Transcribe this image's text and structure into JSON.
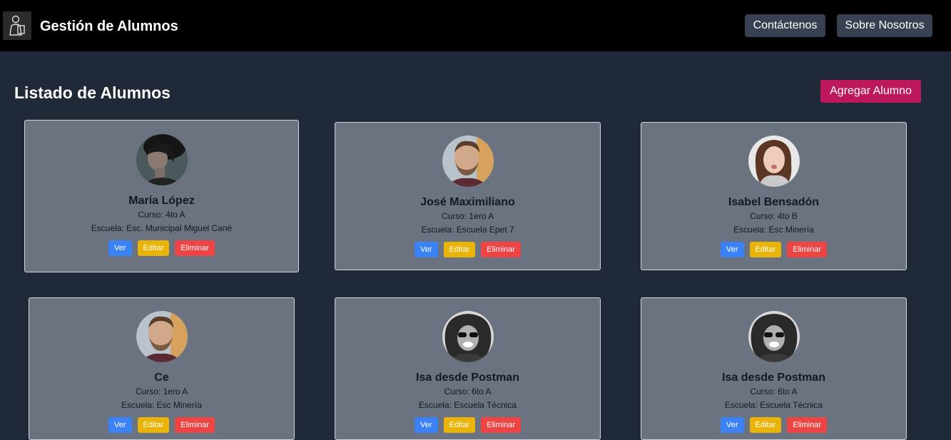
{
  "header": {
    "title": "Gestión de Alumnos",
    "nav": {
      "contact": "Contáctenos",
      "about": "Sobre Nosotros"
    }
  },
  "main": {
    "title": "Listado de Alumnos",
    "add_button": "Agregar Alumno"
  },
  "labels": {
    "view": "Ver",
    "edit": "Editar",
    "delete": "Eliminar"
  },
  "students": [
    {
      "name": "María López",
      "curso": "Curso: 4to A",
      "escuela": "Escuela: Esc. Municipal Miguel Cané",
      "avatar": "woman-dark-hair"
    },
    {
      "name": "José Maximiliano",
      "curso": "Curso: 1ero A",
      "escuela": "Escuela: Escuela Epet 7",
      "avatar": "man-beard"
    },
    {
      "name": "Isabel Bensadón",
      "curso": "Curso: 4to B",
      "escuela": "Escuela: Esc Minería",
      "avatar": "woman-light"
    },
    {
      "name": "Ce",
      "curso": "Curso: 1ero A",
      "escuela": "Escuela: Esc Minería",
      "avatar": "man-beard"
    },
    {
      "name": "Isa desde Postman",
      "curso": "Curso: 6to A",
      "escuela": "Escuela: Escuela Técnica",
      "avatar": "woman-bw-curly"
    },
    {
      "name": "Isa desde Postman",
      "curso": "Curso: 6to A",
      "escuela": "Escuela: Escuela Técnica",
      "avatar": "woman-bw-curly"
    }
  ],
  "colors": {
    "background": "#1f2937",
    "navbar": "#000000",
    "card": "#6b7280",
    "accent": "#be185d",
    "view": "#3b82f6",
    "edit": "#eab308",
    "delete": "#ef4444"
  }
}
